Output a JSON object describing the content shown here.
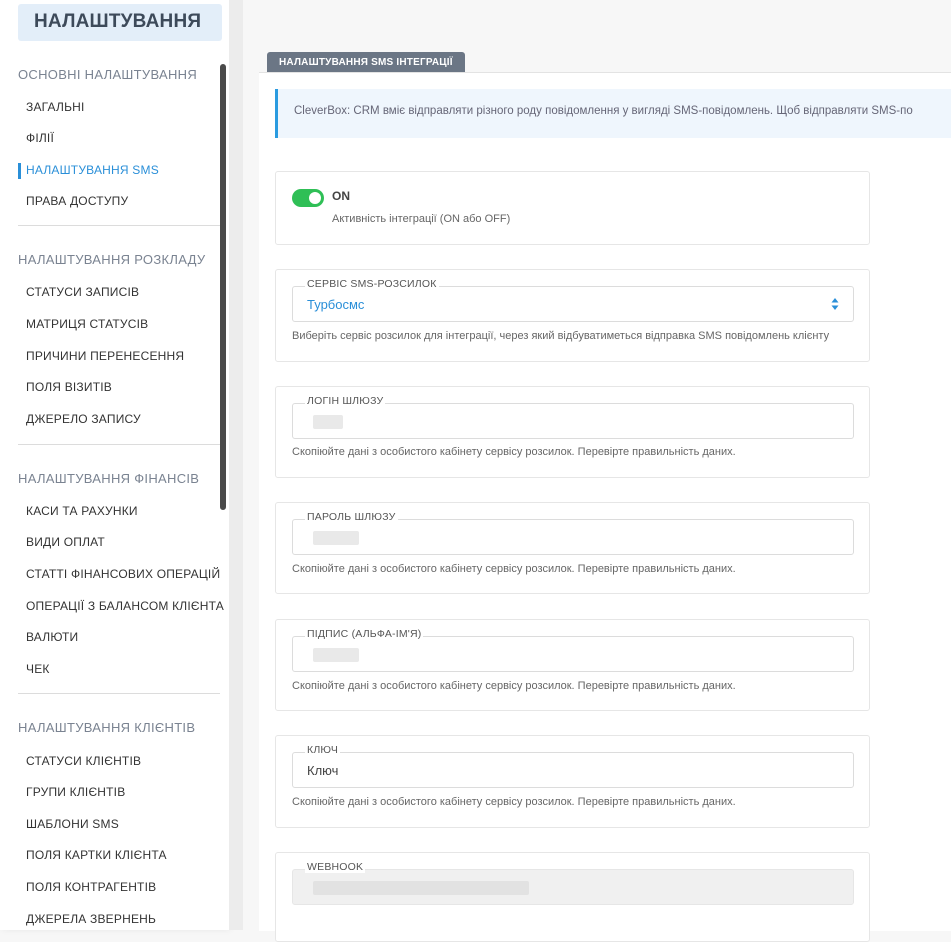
{
  "sidebar": {
    "title": "НАЛАШТУВАННЯ",
    "sections": [
      {
        "title": "ОСНОВНІ НАЛАШТУВАННЯ",
        "items": [
          "ЗАГАЛЬНІ",
          "ФІЛІЇ",
          "НАЛАШТУВАННЯ SMS",
          "ПРАВА ДОСТУПУ"
        ]
      },
      {
        "title": "НАЛАШТУВАННЯ РОЗКЛАДУ",
        "items": [
          "СТАТУСИ ЗАПИСІВ",
          "МАТРИЦЯ СТАТУСІВ",
          "ПРИЧИНИ ПЕРЕНЕСЕННЯ",
          "ПОЛЯ ВІЗИТІВ",
          "ДЖЕРЕЛО ЗАПИСУ"
        ]
      },
      {
        "title": "НАЛАШТУВАННЯ ФІНАНСІВ",
        "items": [
          "КАСИ ТА РАХУНКИ",
          "ВИДИ ОПЛАТ",
          "СТАТТІ ФІНАНСОВИХ ОПЕРАЦІЙ",
          "ОПЕРАЦІЇ З БАЛАНСОМ КЛІЄНТА",
          "ВАЛЮТИ",
          "ЧЕК"
        ]
      },
      {
        "title": "НАЛАШТУВАННЯ КЛІЄНТІВ",
        "items": [
          "СТАТУСИ КЛІЄНТІВ",
          "ГРУПИ КЛІЄНТІВ",
          "ШАБЛОНИ SMS",
          "ПОЛЯ КАРТКИ КЛІЄНТА",
          "ПОЛЯ КОНТРАГЕНТІВ",
          "ДЖЕРЕЛА ЗВЕРНЕНЬ"
        ]
      }
    ],
    "active_item": "НАЛАШТУВАННЯ SMS"
  },
  "tab": {
    "label": "НАЛАШТУВАННЯ SMS ІНТЕГРАЦІЇ"
  },
  "info": {
    "text": "CleverBox: CRM вміє відправляти різного роду повідомлення у вигляді SMS-повідомлень. Щоб відправляти SMS-по"
  },
  "activity": {
    "state": "ON",
    "help": "Активність інтеграції (ON або OFF)"
  },
  "service": {
    "label": "СЕРВІС SMS-РОЗСИЛОК",
    "value": "Турбосмс",
    "help": "Виберіть сервіс розсилок для інтеграції, через який відбуватиметься відправка SMS повідомлень клієнту"
  },
  "login": {
    "label": "ЛОГІН ШЛЮЗУ",
    "help": "Скопіюйте дані з особистого кабінету сервісу розсилок. Перевірте правильність даних."
  },
  "password": {
    "label": "ПАРОЛЬ ШЛЮЗУ",
    "help": "Скопіюйте дані з особистого кабінету сервісу розсилок. Перевірте правильність даних."
  },
  "signature": {
    "label": "ПІДПИС (АЛЬФА-ІМ'Я)",
    "help": "Скопіюйте дані з особистого кабінету сервісу розсилок. Перевірте правильність даних."
  },
  "key": {
    "label": "КЛЮЧ",
    "placeholder": "Ключ",
    "help": "Скопіюйте дані з особистого кабінету сервісу розсилок. Перевірте правильність даних."
  },
  "webhook": {
    "label": "WEBHOOK"
  },
  "colors": {
    "accent": "#2a8fd8",
    "toggle_on": "#2fbf56",
    "tab_bg": "#6b7685"
  }
}
